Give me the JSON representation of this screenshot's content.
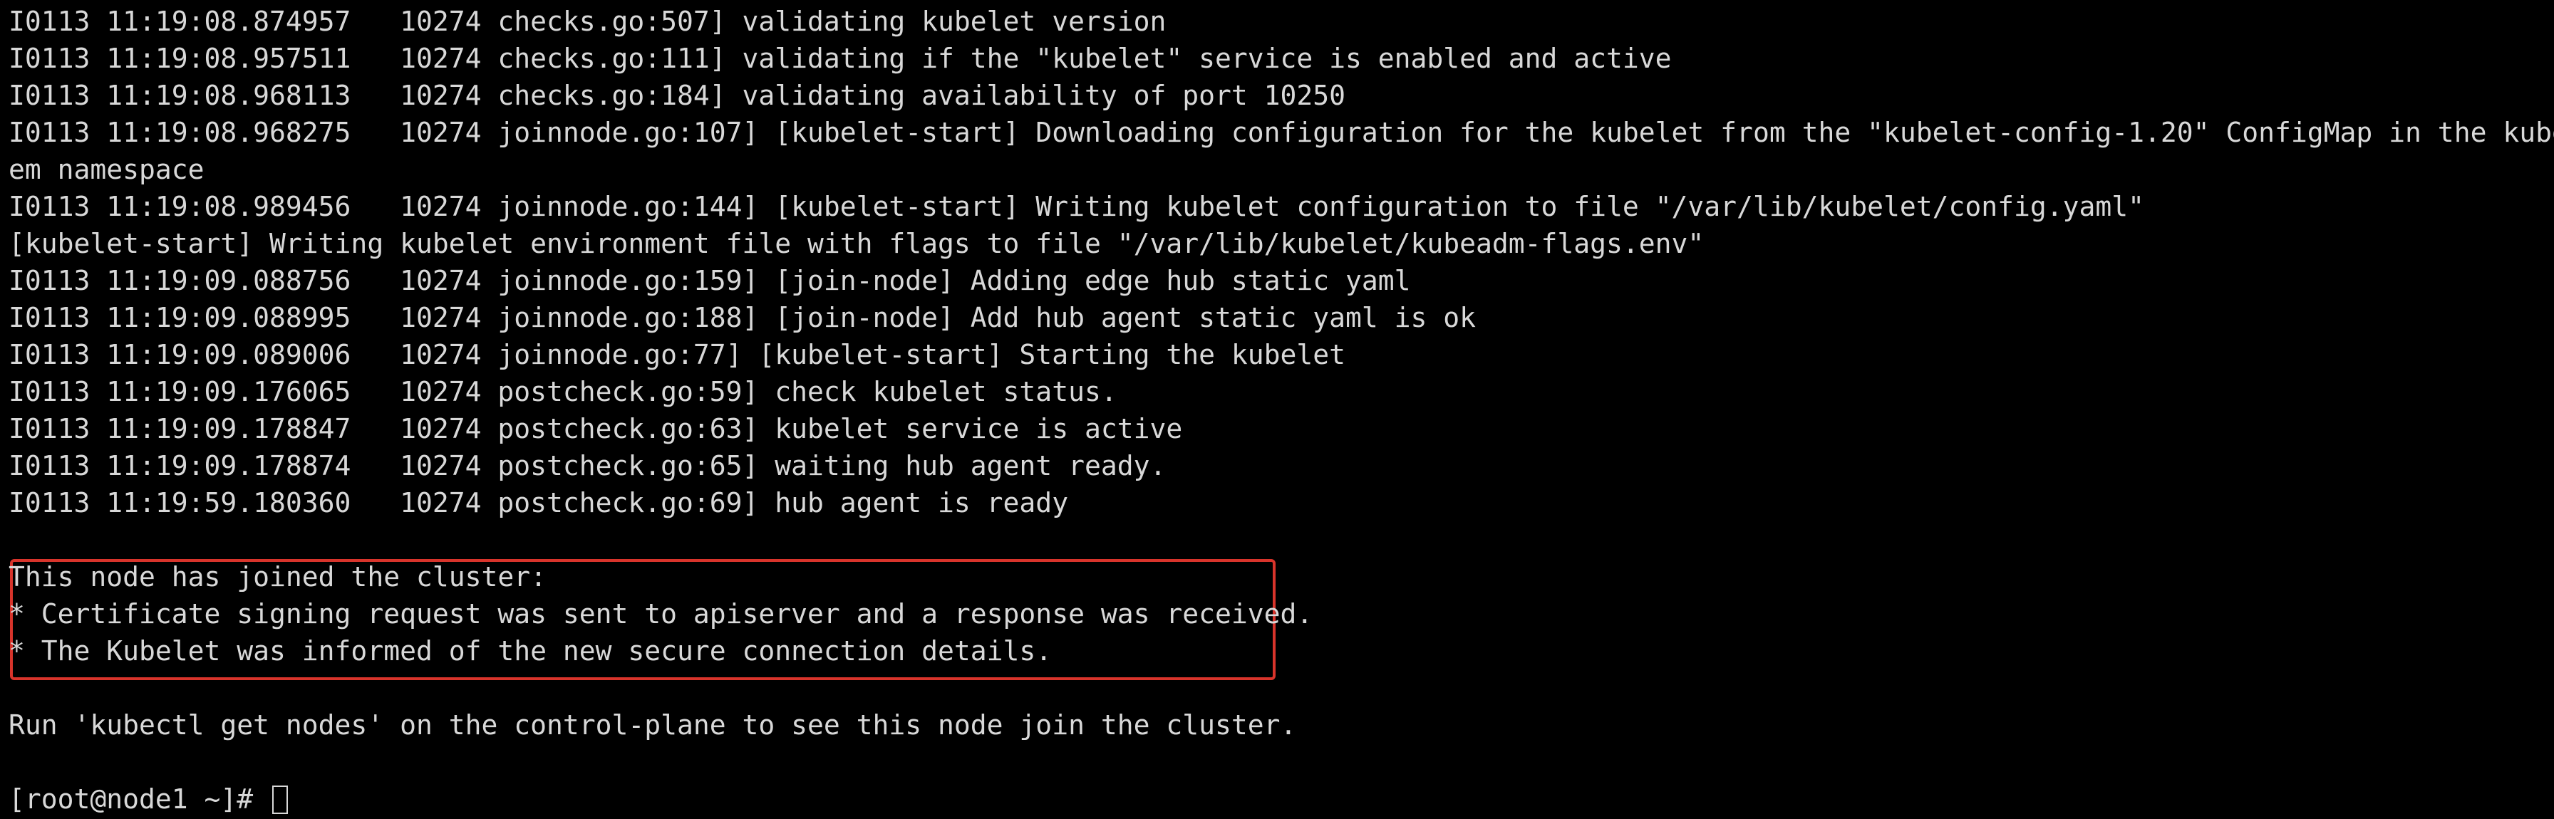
{
  "terminal": {
    "lines": [
      "I0113 11:19:08.874957   10274 checks.go:507] validating kubelet version",
      "I0113 11:19:08.957511   10274 checks.go:111] validating if the \"kubelet\" service is enabled and active",
      "I0113 11:19:08.968113   10274 checks.go:184] validating availability of port 10250",
      "I0113 11:19:08.968275   10274 joinnode.go:107] [kubelet-start] Downloading configuration for the kubelet from the \"kubelet-config-1.20\" ConfigMap in the kube-syst",
      "em namespace",
      "I0113 11:19:08.989456   10274 joinnode.go:144] [kubelet-start] Writing kubelet configuration to file \"/var/lib/kubelet/config.yaml\"",
      "[kubelet-start] Writing kubelet environment file with flags to file \"/var/lib/kubelet/kubeadm-flags.env\"",
      "I0113 11:19:09.088756   10274 joinnode.go:159] [join-node] Adding edge hub static yaml",
      "I0113 11:19:09.088995   10274 joinnode.go:188] [join-node] Add hub agent static yaml is ok",
      "I0113 11:19:09.089006   10274 joinnode.go:77] [kubelet-start] Starting the kubelet",
      "I0113 11:19:09.176065   10274 postcheck.go:59] check kubelet status.",
      "I0113 11:19:09.178847   10274 postcheck.go:63] kubelet service is active",
      "I0113 11:19:09.178874   10274 postcheck.go:65] waiting hub agent ready.",
      "I0113 11:19:59.180360   10274 postcheck.go:69] hub agent is ready",
      "",
      "This node has joined the cluster:",
      "* Certificate signing request was sent to apiserver and a response was received.",
      "* The Kubelet was informed of the new secure connection details.",
      "",
      "Run 'kubectl get nodes' on the control-plane to see this node join the cluster.",
      ""
    ],
    "prompt": "[root@node1 ~]# ",
    "colors": {
      "background": "#000000",
      "text": "#d8d8d8",
      "highlight_border": "#d8342b"
    }
  }
}
